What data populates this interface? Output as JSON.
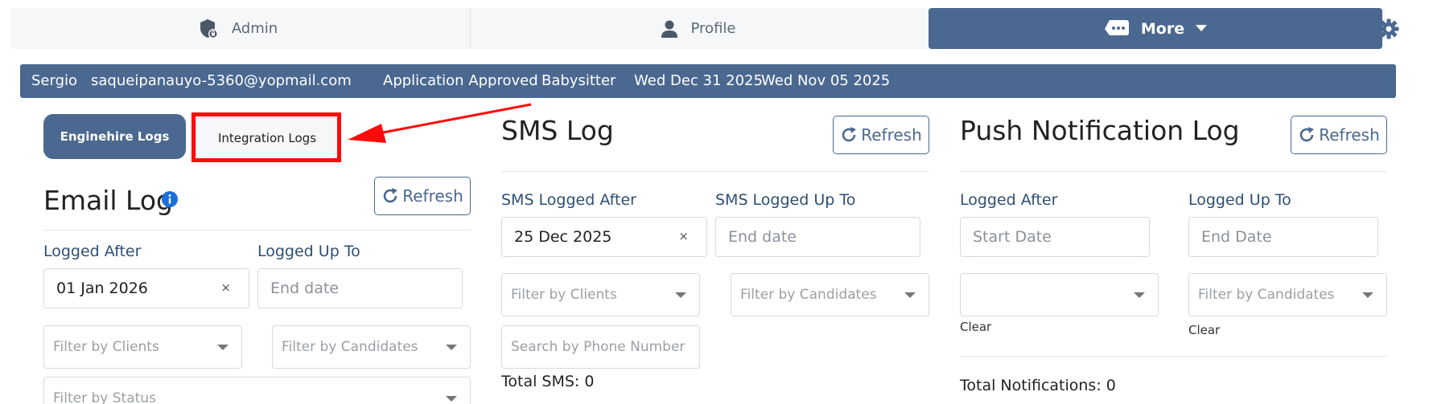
{
  "nav": {
    "tabs": [
      {
        "label": "Admin",
        "icon": "shield-icon"
      },
      {
        "label": "Profile",
        "icon": "user-icon"
      },
      {
        "label": "More",
        "icon": "message-dots-icon"
      }
    ],
    "settings_icon": "gear-icon"
  },
  "userbar": {
    "name": "Sergio",
    "email": "saqueipanauyo-5360@yopmail.com",
    "status": "Application Approved",
    "role": "Babysitter",
    "date1": "Wed Dec 31 2025",
    "date2": "Wed Nov 05 2025"
  },
  "log_tabs": {
    "enginehire": "Enginehire Logs",
    "integration": "Integration Logs"
  },
  "email_log": {
    "title": "Email Log",
    "refresh": "Refresh",
    "after_label": "Logged After",
    "upto_label": "Logged Up To",
    "after_value": "01 Jan 2026",
    "clear_symbol": "×",
    "upto_placeholder": "End date",
    "clients_placeholder": "Filter by Clients",
    "candidates_placeholder": "Filter by Candidates",
    "status_placeholder": "Filter by Status"
  },
  "sms_log": {
    "title": "SMS Log",
    "refresh": "Refresh",
    "after_label": "SMS Logged After",
    "upto_label": "SMS Logged Up To",
    "after_value": "25 Dec 2025",
    "clear_symbol": "×",
    "upto_placeholder": "End date",
    "clients_placeholder": "Filter by Clients",
    "candidates_placeholder": "Filter by Candidates",
    "phone_placeholder": "Search by Phone Number",
    "total": "Total SMS: 0"
  },
  "push_log": {
    "title": "Push Notification Log",
    "refresh": "Refresh",
    "after_label": "Logged After",
    "upto_label": "Logged Up To",
    "after_placeholder": "Start Date",
    "upto_placeholder": "End Date",
    "candidates_placeholder": "Filter by Candidates",
    "clear1": "Clear",
    "clear2": "Clear",
    "total": "Total Notifications: 0"
  },
  "colors": {
    "primary": "#4a6890",
    "label": "#2e4f73",
    "annotation": "#ff0a0a"
  }
}
